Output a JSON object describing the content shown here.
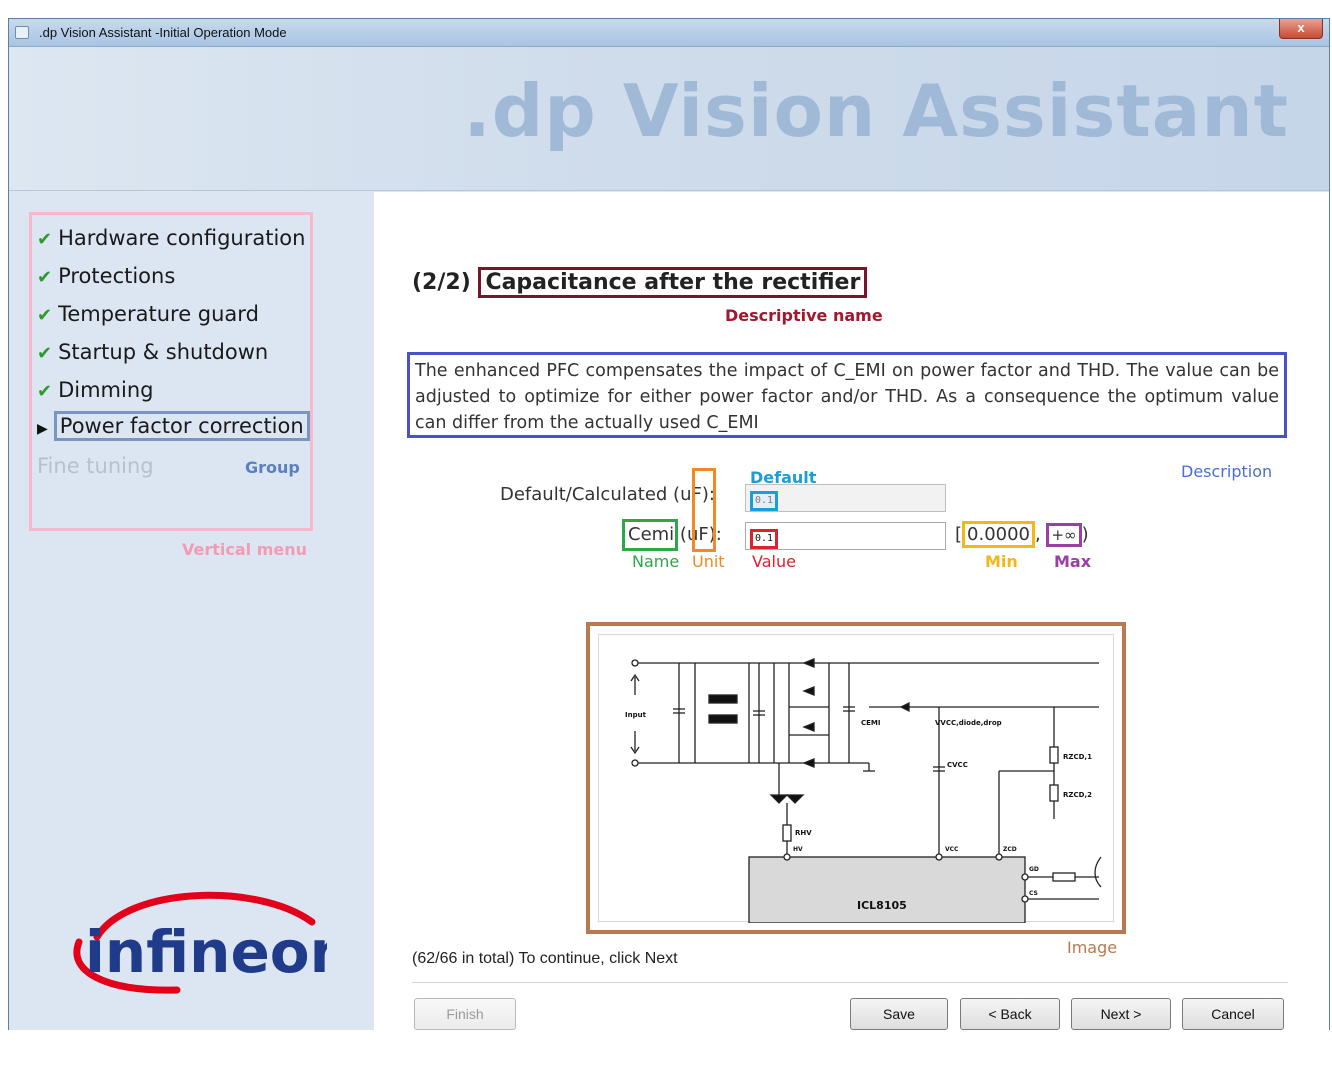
{
  "window": {
    "title": ".dp Vision Assistant -Initial Operation Mode",
    "close_label": "x"
  },
  "banner": {
    "brand": ".dp Vision Assistant"
  },
  "menu": {
    "items": [
      {
        "label": "Hardware configuration",
        "state": "done"
      },
      {
        "label": "Protections",
        "state": "done"
      },
      {
        "label": "Temperature guard",
        "state": "done"
      },
      {
        "label": "Startup & shutdown",
        "state": "done"
      },
      {
        "label": "Dimming",
        "state": "done"
      },
      {
        "label": "Power factor correction",
        "state": "current"
      },
      {
        "label": "Fine tuning",
        "state": "disabled"
      }
    ],
    "check_glyph": "✔",
    "arrow_glyph": "▶"
  },
  "annotations": {
    "group": "Group",
    "vertical_menu": "Vertical menu",
    "descriptive_name": "Descriptive name",
    "description": "Description",
    "default": "Default",
    "name": "Name",
    "unit": "Unit",
    "value": "Value",
    "min": "Min",
    "max": "Max",
    "image": "Image"
  },
  "page": {
    "step": "(2/2)",
    "name": "Capacitance after the rectifier",
    "description": "The enhanced PFC compensates the impact of C_EMI on power factor and THD. The value can be adjusted to optimize for either power factor and/or THD. As a consequence the optimum value can differ from the actually used C_EMI"
  },
  "form": {
    "default_label_prefix": "Default/Calculated (",
    "default_unit": "uF",
    "default_label_suffix": "):",
    "default_value": "0.1",
    "param_name": "Cemi",
    "param_unit": "uF",
    "param_suffix": "):",
    "param_value": "0.1",
    "range_open": "[",
    "min": "0.0000",
    "range_sep": ",",
    "max": "+∞",
    "range_close": ")"
  },
  "schematic": {
    "input_label": "Input",
    "cemi_label": "CEMI",
    "vcc_drop_label": "VVCC,diode,drop",
    "cvcc_label": "CVCC",
    "rzcd1_label": "RZCD,1",
    "rzcd2_label": "RZCD,2",
    "rhv_label": "RHV",
    "pin_hv": "HV",
    "pin_vcc": "VCC",
    "pin_zcd": "ZCD",
    "pin_gd": "GD",
    "pin_cs": "CS",
    "chip": "ICL8105"
  },
  "footer": {
    "progress": "(62/66 in total) To continue, click Next"
  },
  "buttons": {
    "finish": "Finish",
    "save": "Save",
    "back": "< Back",
    "next": "Next >",
    "cancel": "Cancel"
  },
  "logo": {
    "text": "infineon"
  },
  "colors": {
    "menu_highlight": "#f7b8cb",
    "group_highlight": "#7a96c0",
    "name_highlight": "#7a1428",
    "description_highlight": "#4a52c8",
    "default_highlight": "#1a9ed8",
    "unit_highlight": "#f08a24",
    "cemi_highlight": "#2ea64a",
    "value_highlight": "#e0202e",
    "min_highlight": "#f3b71b",
    "max_highlight": "#9b3fa6",
    "image_highlight": "#b87850"
  }
}
